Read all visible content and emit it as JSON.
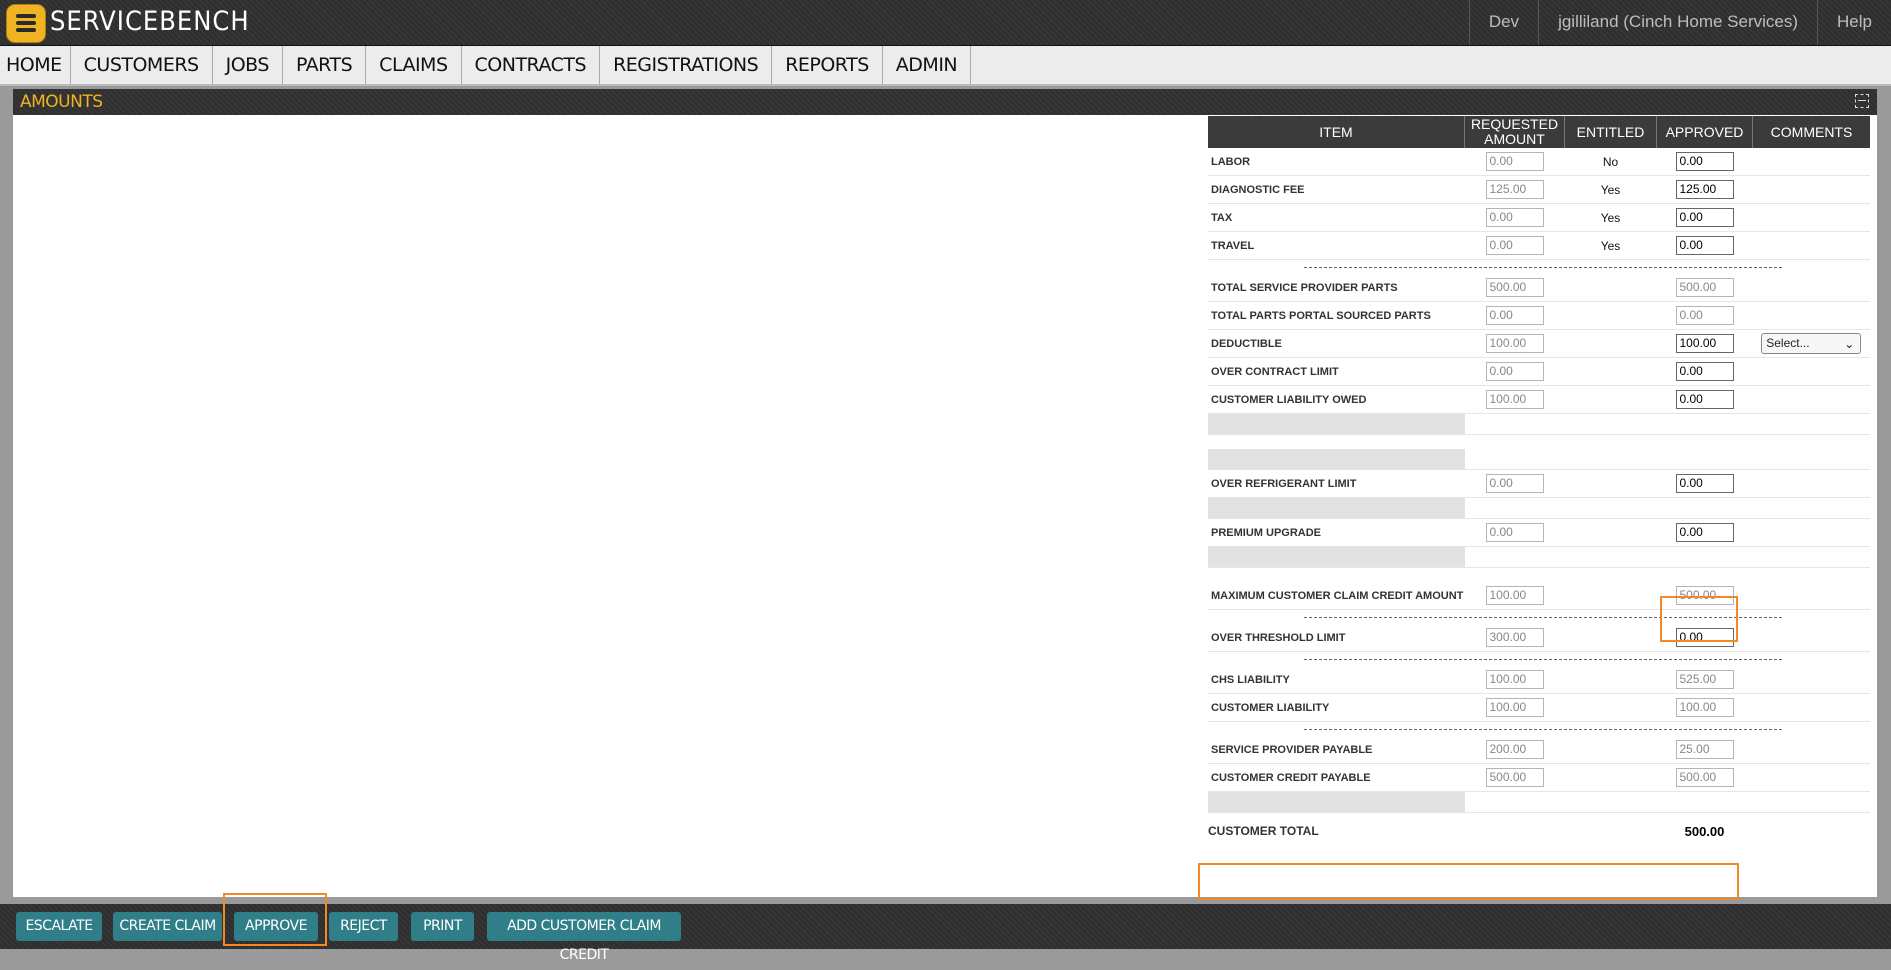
{
  "app": {
    "logo_text": "SERVICEBENCH",
    "env": "Dev",
    "user": "jgilliland (Cinch Home Services)",
    "help": "Help"
  },
  "nav": [
    "HOME",
    "CUSTOMERS",
    "JOBS",
    "PARTS",
    "CLAIMS",
    "CONTRACTS",
    "REGISTRATIONS",
    "REPORTS",
    "ADMIN"
  ],
  "panel": {
    "title": "AMOUNTS"
  },
  "table": {
    "headers": {
      "item": "ITEM",
      "requested": "REQUESTED AMOUNT",
      "entitled": "ENTITLED",
      "approved": "APPROVED",
      "comments": "COMMENTS"
    },
    "rows": {
      "labor": {
        "item": "LABOR",
        "req": "0.00",
        "ent": "No",
        "app": "0.00"
      },
      "diag": {
        "item": "DIAGNOSTIC FEE",
        "req": "125.00",
        "ent": "Yes",
        "app": "125.00"
      },
      "tax": {
        "item": "TAX",
        "req": "0.00",
        "ent": "Yes",
        "app": "0.00"
      },
      "travel": {
        "item": "TRAVEL",
        "req": "0.00",
        "ent": "Yes",
        "app": "0.00"
      },
      "tsp": {
        "item": "TOTAL SERVICE PROVIDER PARTS",
        "req": "500.00",
        "app": "500.00"
      },
      "tpp": {
        "item": "TOTAL PARTS PORTAL SOURCED PARTS",
        "req": "0.00",
        "app": "0.00"
      },
      "ded": {
        "item": "DEDUCTIBLE",
        "req": "100.00",
        "app": "100.00",
        "select": "Select..."
      },
      "ocl": {
        "item": "OVER CONTRACT LIMIT",
        "req": "0.00",
        "app": "0.00"
      },
      "clo": {
        "item": "CUSTOMER LIABILITY OWED",
        "req": "100.00",
        "app": "0.00"
      },
      "orl": {
        "item": "OVER REFRIGERANT LIMIT",
        "req": "0.00",
        "app": "0.00"
      },
      "pu": {
        "item": "PREMIUM UPGRADE",
        "req": "0.00",
        "app": "0.00"
      },
      "mcc": {
        "item": "MAXIMUM CUSTOMER CLAIM CREDIT AMOUNT",
        "req": "100.00",
        "app": "500.00"
      },
      "otl": {
        "item": "OVER THRESHOLD LIMIT",
        "req": "300.00",
        "app": "0.00"
      },
      "chs": {
        "item": "CHS LIABILITY",
        "req": "100.00",
        "app": "525.00"
      },
      "cl": {
        "item": "CUSTOMER LIABILITY",
        "req": "100.00",
        "app": "100.00"
      },
      "spp": {
        "item": "SERVICE PROVIDER PAYABLE",
        "req": "200.00",
        "app": "25.00"
      },
      "ccp": {
        "item": "CUSTOMER CREDIT PAYABLE",
        "req": "500.00",
        "app": "500.00"
      }
    },
    "total": {
      "label": "CUSTOMER TOTAL",
      "value": "500.00"
    }
  },
  "footer": {
    "escalate": "ESCALATE",
    "create_claim": "CREATE CLAIM",
    "approve": "APPROVE",
    "reject": "REJECT",
    "print": "PRINT",
    "add_credit": "ADD CUSTOMER CLAIM CREDIT"
  },
  "colors": {
    "brand": "#f0b323",
    "button": "#2f7e88",
    "highlight": "#f08a24",
    "header_bg": "#2e2e2e"
  }
}
